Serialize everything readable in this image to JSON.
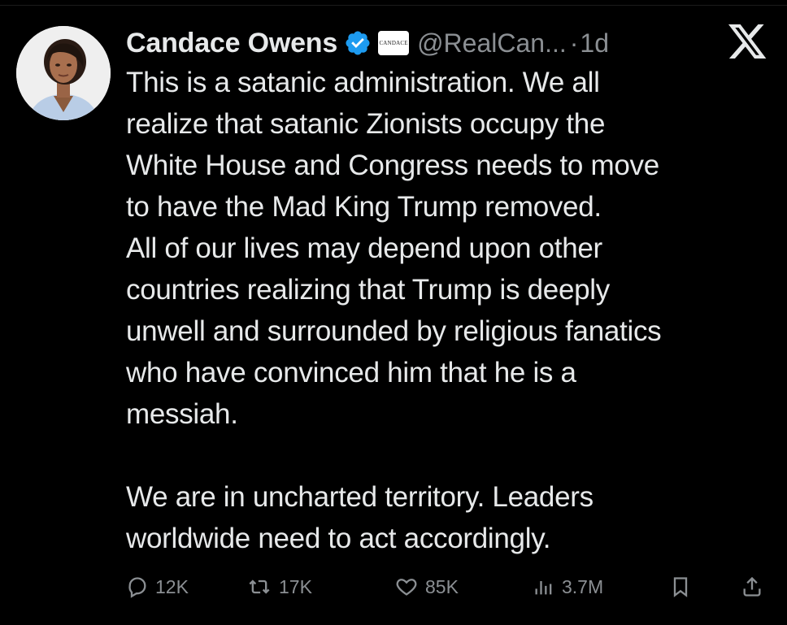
{
  "author": {
    "display_name": "Candace Owens",
    "handle": "@RealCan...",
    "separator": "·",
    "time": "1d",
    "affiliate_badge_text": "CANDACE",
    "verified_color": "#1d9bf0"
  },
  "tweet": {
    "paragraph1_lines": [
      "This is a satanic administration. We all",
      "realize that satanic Zionists occupy the",
      "White House and Congress needs to move",
      "to have the Mad King Trump removed.",
      "All of our lives may depend upon other",
      "countries realizing that Trump is deeply",
      "unwell and surrounded by religious fanatics",
      "who have convinced him that he is a",
      "messiah."
    ],
    "paragraph2_lines": [
      "We are in uncharted territory. Leaders",
      "worldwide need to act accordingly."
    ]
  },
  "actions": {
    "replies": "12K",
    "reposts": "17K",
    "likes": "85K",
    "views": "3.7M"
  },
  "icons": {
    "platform": "x-logo-icon",
    "reply": "reply-icon",
    "repost": "repost-icon",
    "like": "heart-icon",
    "views": "views-icon",
    "bookmark": "bookmark-icon",
    "share": "share-icon"
  }
}
